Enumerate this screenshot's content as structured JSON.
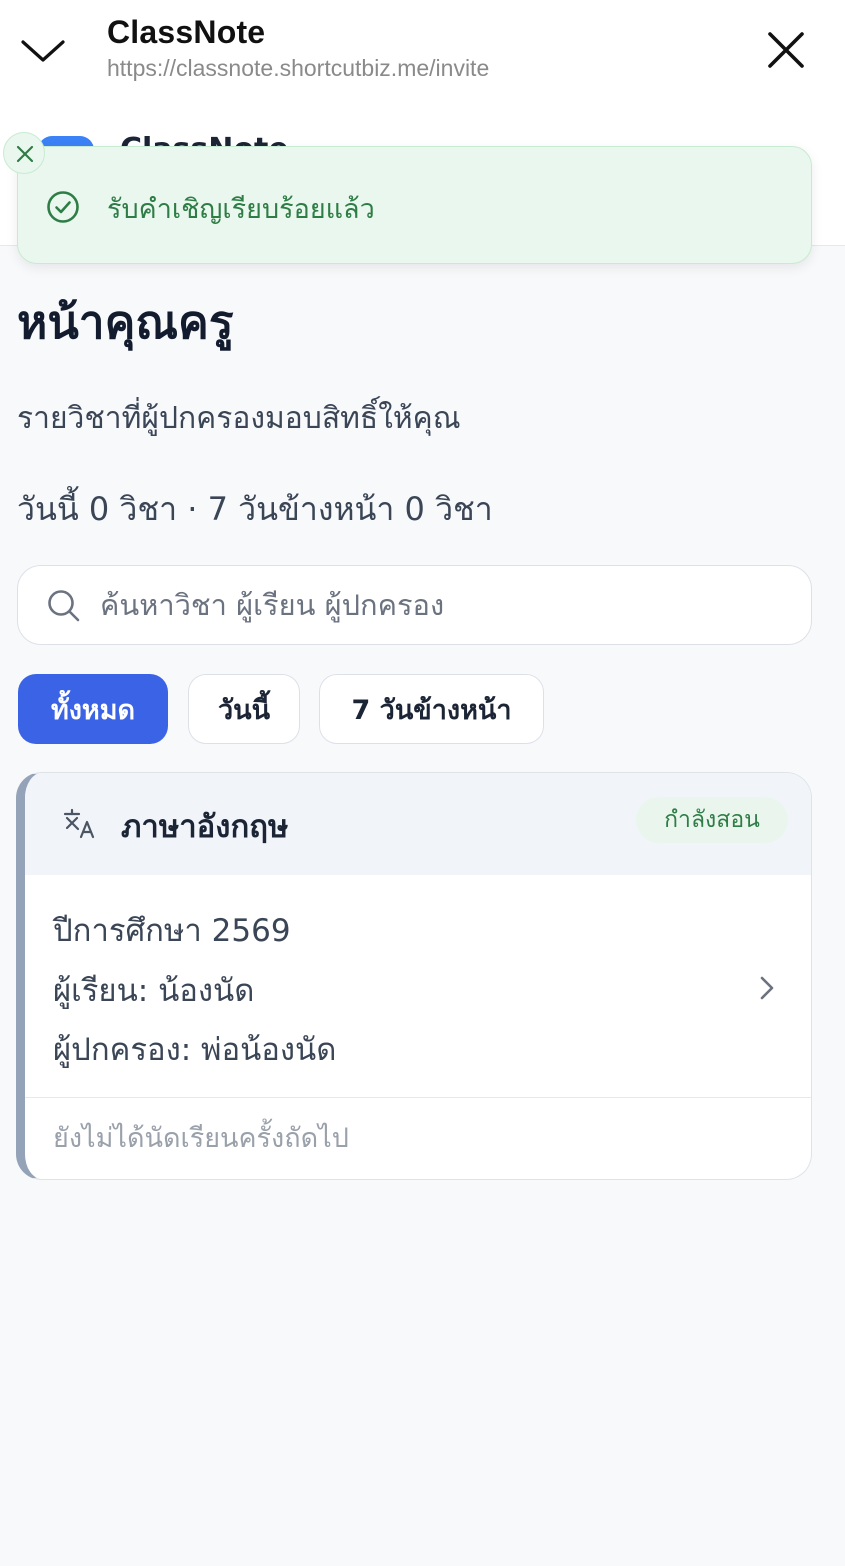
{
  "browser": {
    "title": "ClassNote",
    "url": "https://classnote.shortcutbiz.me/invite"
  },
  "app_header": {
    "name": "ClassNote"
  },
  "toast": {
    "message": "รับคำเชิญเรียบร้อยแล้ว"
  },
  "page": {
    "title": "หน้าคุณครู",
    "subtitle": "รายวิชาที่ผู้ปกครองมอบสิทธิ์ให้คุณ",
    "stats": "วันนี้ 0 วิชา · 7 วันข้างหน้า 0 วิชา"
  },
  "search": {
    "placeholder": "ค้นหาวิชา ผู้เรียน ผู้ปกครอง",
    "value": ""
  },
  "filters": [
    {
      "label": "ทั้งหมด",
      "selected": true
    },
    {
      "label": "วันนี้",
      "selected": false
    },
    {
      "label": "7 วันข้างหน้า",
      "selected": false
    }
  ],
  "card": {
    "subject": "ภาษาอังกฤษ",
    "icon": "translate-icon",
    "status": "กำลังสอน",
    "year": "ปีการศึกษา 2569",
    "student": "ผู้เรียน: น้องนัด",
    "parent": "ผู้ปกครอง: พ่อน้องนัด",
    "next_session": "ยังไม่ได้นัดเรียนครั้งถัดไป"
  },
  "colors": {
    "primary": "#3b63e6",
    "success_bg": "#eaf7ee",
    "success_text": "#2f7d46",
    "card_accent": "#94a3b8"
  }
}
